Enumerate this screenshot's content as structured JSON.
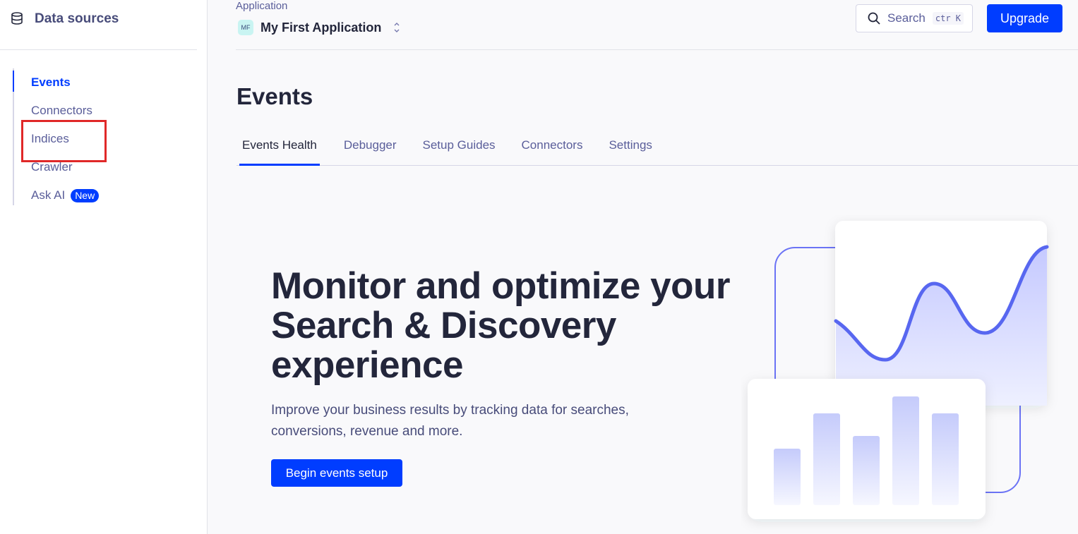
{
  "sidebar": {
    "title": "Data sources",
    "items": [
      {
        "label": "Events",
        "active": true
      },
      {
        "label": "Connectors"
      },
      {
        "label": "Indices",
        "highlighted": true
      },
      {
        "label": "Crawler"
      },
      {
        "label": "Ask AI",
        "badge": "New"
      }
    ]
  },
  "topbar": {
    "app_label": "Application",
    "app_avatar": "MF",
    "app_name": "My First Application",
    "search_label": "Search",
    "search_shortcut": "ctr K",
    "upgrade_label": "Upgrade"
  },
  "page": {
    "title": "Events",
    "tabs": [
      {
        "label": "Events Health",
        "active": true
      },
      {
        "label": "Debugger"
      },
      {
        "label": "Setup Guides"
      },
      {
        "label": "Connectors"
      },
      {
        "label": "Settings"
      }
    ]
  },
  "hero": {
    "title": "Monitor and optimize your Search & Discovery experience",
    "subtitle": "Improve your business results by tracking data for searches, conversions, revenue and more.",
    "cta_label": "Begin events setup"
  },
  "colors": {
    "accent": "#003dff",
    "text_primary": "#23263b",
    "text_secondary": "#5a5e9a",
    "highlight_border": "#e02828"
  }
}
